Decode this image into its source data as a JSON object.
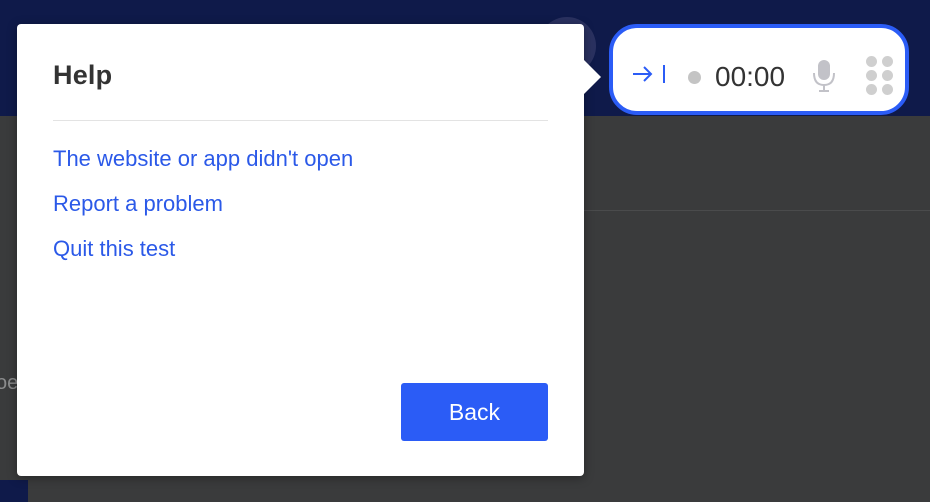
{
  "dialog": {
    "title": "Help",
    "links": [
      {
        "label": "The website or app didn't open"
      },
      {
        "label": "Report a problem"
      },
      {
        "label": "Quit this test"
      }
    ],
    "back_label": "Back"
  },
  "recorder": {
    "timer": "00:00",
    "icons": [
      "collapse-icon",
      "recording-dot-icon",
      "microphone-icon",
      "drag-handle-icon"
    ]
  },
  "background": {
    "fragment_text": "oe"
  },
  "colors": {
    "accent": "#2b5cf6",
    "link": "#2b59e8",
    "topbar": "#0f1a4a",
    "overlay": "#3a3b3c"
  }
}
